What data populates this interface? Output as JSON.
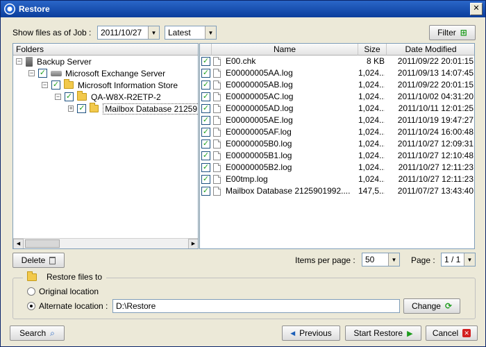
{
  "title": "Restore",
  "toolbar": {
    "show_files_label": "Show files as of Job :",
    "date_value": "2011/10/27",
    "version_value": "Latest",
    "filter_label": "Filter"
  },
  "tree": {
    "header": "Folders",
    "nodes": [
      {
        "label": "Backup Server"
      },
      {
        "label": "Microsoft Exchange Server"
      },
      {
        "label": "Microsoft Information Store"
      },
      {
        "label": "QA-W8X-R2ETP-2"
      },
      {
        "label": "Mailbox Database 21259"
      }
    ]
  },
  "files": {
    "headers": {
      "name": "Name",
      "size": "Size",
      "date": "Date Modified"
    },
    "rows": [
      {
        "name": "E00.chk",
        "size": "8 KB",
        "date": "2011/09/22 20:01:15"
      },
      {
        "name": "E00000005AA.log",
        "size": "1,024...",
        "date": "2011/09/13 14:07:45"
      },
      {
        "name": "E00000005AB.log",
        "size": "1,024...",
        "date": "2011/09/22 20:01:15"
      },
      {
        "name": "E00000005AC.log",
        "size": "1,024...",
        "date": "2011/10/02 04:31:20"
      },
      {
        "name": "E00000005AD.log",
        "size": "1,024...",
        "date": "2011/10/11 12:01:25"
      },
      {
        "name": "E00000005AE.log",
        "size": "1,024...",
        "date": "2011/10/19 19:47:27"
      },
      {
        "name": "E00000005AF.log",
        "size": "1,024...",
        "date": "2011/10/24 16:00:48"
      },
      {
        "name": "E00000005B0.log",
        "size": "1,024...",
        "date": "2011/10/27 12:09:31"
      },
      {
        "name": "E00000005B1.log",
        "size": "1,024...",
        "date": "2011/10/27 12:10:48"
      },
      {
        "name": "E00000005B2.log",
        "size": "1,024...",
        "date": "2011/10/27 12:11:23"
      },
      {
        "name": "E00tmp.log",
        "size": "1,024...",
        "date": "2011/10/27 12:11:23"
      },
      {
        "name": "Mailbox Database 2125901992....",
        "size": "147,5...",
        "date": "2011/07/27 13:43:40"
      }
    ]
  },
  "paging": {
    "delete_label": "Delete",
    "items_per_page_label": "Items per page :",
    "items_per_page_value": "50",
    "page_label": "Page :",
    "page_value": "1 / 1"
  },
  "restore": {
    "group_label": "Restore files to",
    "original_label": "Original location",
    "alternate_label": "Alternate location :",
    "alternate_value": "D:\\Restore",
    "change_label": "Change"
  },
  "footer": {
    "search_label": "Search",
    "previous_label": "Previous",
    "start_label": "Start Restore",
    "cancel_label": "Cancel"
  }
}
